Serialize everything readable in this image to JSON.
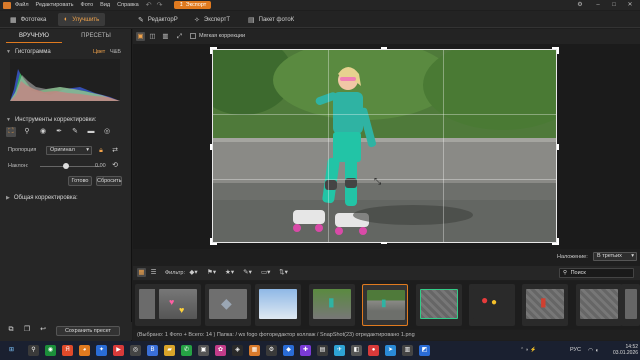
{
  "menu": {
    "items": [
      "Файл",
      "Редактировать",
      "Фото",
      "Вид",
      "Справка"
    ],
    "export_label": "Экспорт"
  },
  "modules": [
    {
      "label": "Фототека",
      "icon": "gallery-icon"
    },
    {
      "label": "Улучшить",
      "icon": "enhance-icon"
    },
    {
      "label": "РедакторP",
      "icon": "editor-icon"
    },
    {
      "label": "ЭкспертТ",
      "icon": "expert-icon"
    },
    {
      "label": "Пакет фотоК",
      "icon": "batch-icon"
    }
  ],
  "left_panel": {
    "tabs": [
      "ВРУЧНУЮ",
      "ПРЕСЕТЫ"
    ],
    "histogram": {
      "title": "Гистограмма",
      "mode_color": "Цвет",
      "mode_bw": "Ч&Б"
    },
    "tools_title": "Инструменты корректировки:",
    "tools": [
      "crop-icon",
      "brush-icon",
      "eye-icon",
      "pen-icon",
      "pencil-icon",
      "gradient-icon",
      "radial-icon"
    ],
    "proportion_label": "Пропорция",
    "proportion_value": "Оригинал",
    "tilt_label": "Наклон:",
    "tilt_value": "0.00",
    "done_button": "Готово",
    "reset_button": "Сбросить",
    "general_title": "Общая корректировка:",
    "save_preset_button": "Сохранить пресет"
  },
  "toolbar": {
    "soft_correction_label": "Мягкая коррекции"
  },
  "overlay": {
    "label": "Наложение:",
    "value": "В третьих"
  },
  "filmstrip_toolbar": {
    "filter_label": "Фильтр:",
    "search_placeholder": "Поиск"
  },
  "statusbar": {
    "text": "(Выбрано: 1 Фото + Всего: 14 )   Папка: / ws fogo фоторедактор коллаж / SnapShot(23) отредактировано 1.png"
  },
  "taskbar": {
    "lang": "РУС",
    "time": "14:52",
    "date": "03.01.2026"
  },
  "colors": {
    "accent": "#e07a1f",
    "background": "#1e1e1e",
    "panel": "#262626"
  }
}
